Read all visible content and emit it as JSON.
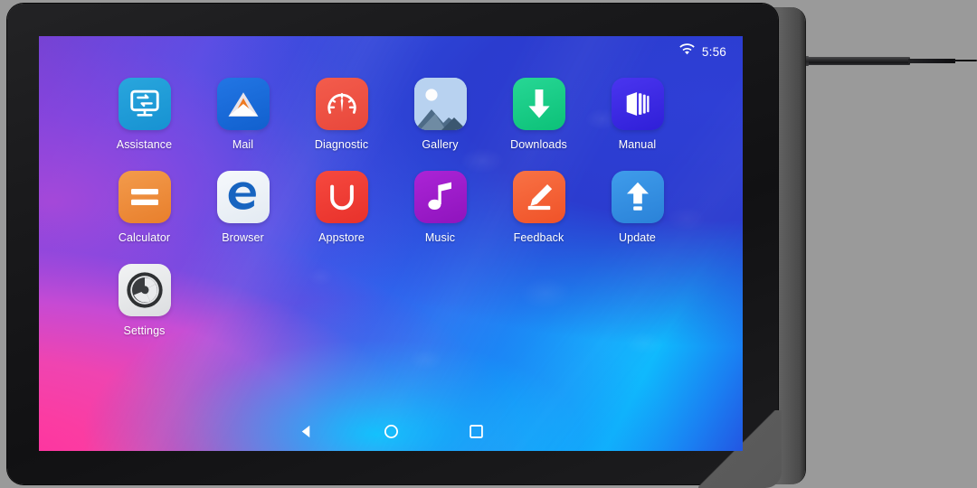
{
  "device": {
    "type": "android-tablet",
    "accessory": "stylus-pen",
    "bezel_color": "#17171a",
    "side_edge_color": "#5c5c5c",
    "background_color": "#9a9a9a"
  },
  "status_bar": {
    "wifi_icon": "wifi-icon",
    "time": "5:56",
    "text_color": "#ffffff"
  },
  "wallpaper": {
    "style": "abstract-gradient",
    "colors": [
      "#ff2f9e",
      "#a84bd8",
      "#5a4ee4",
      "#2c67ee",
      "#0fb9fd"
    ]
  },
  "home_screen": {
    "apps": [
      {
        "label": "Assistance",
        "icon": "remote-assistance-monitor-icon",
        "tile_color": "#1f9ad6",
        "tile_color2": "#1f9ad6"
      },
      {
        "label": "Mail",
        "icon": "envelope-icon",
        "tile_color": "#1668d8",
        "tile_color2": "#1668d8"
      },
      {
        "label": "Diagnostic",
        "icon": "speedometer-gauge-icon",
        "tile_color": "#ef5243",
        "tile_color2": "#ef5243"
      },
      {
        "label": "Gallery",
        "icon": "photo-mountain-icon",
        "tile_color": "#a9c8ec",
        "tile_color2": "#a9c8ec"
      },
      {
        "label": "Downloads",
        "icon": "download-arrow-icon",
        "tile_color": "#15cb83",
        "tile_color2": "#15cb83"
      },
      {
        "label": "Manual",
        "icon": "open-book-icon",
        "tile_color": "#3a2ae0",
        "tile_color2": "#3a2ae0"
      },
      {
        "label": "Calculator",
        "icon": "equals-sign-icon",
        "tile_color": "#ee8c3c",
        "tile_color2": "#ee8c3c"
      },
      {
        "label": "Browser",
        "icon": "edge-e-icon",
        "tile_color": "#eef2f6",
        "tile_color2": "#eef2f6"
      },
      {
        "label": "Appstore",
        "icon": "shopping-bag-icon",
        "tile_color": "#f03b34",
        "tile_color2": "#f03b34"
      },
      {
        "label": "Music",
        "icon": "music-note-icon",
        "tile_color": "#9b19c9",
        "tile_color2": "#9b19c9"
      },
      {
        "label": "Feedback",
        "icon": "pencil-edit-icon",
        "tile_color": "#f4633a",
        "tile_color2": "#f4633a"
      },
      {
        "label": "Update",
        "icon": "upload-arrow-icon",
        "tile_color": "#2f8fe0",
        "tile_color2": "#2f8fe0"
      },
      {
        "label": "Settings",
        "icon": "gear-icon",
        "tile_color": "#e9eaec",
        "tile_color2": "#e9eaec"
      }
    ]
  },
  "nav_bar": {
    "buttons": [
      {
        "name": "back-button",
        "icon": "back-triangle-icon"
      },
      {
        "name": "home-button",
        "icon": "home-circle-icon"
      },
      {
        "name": "recents-button",
        "icon": "recents-square-icon"
      }
    ],
    "icon_color": "#ffffff"
  }
}
